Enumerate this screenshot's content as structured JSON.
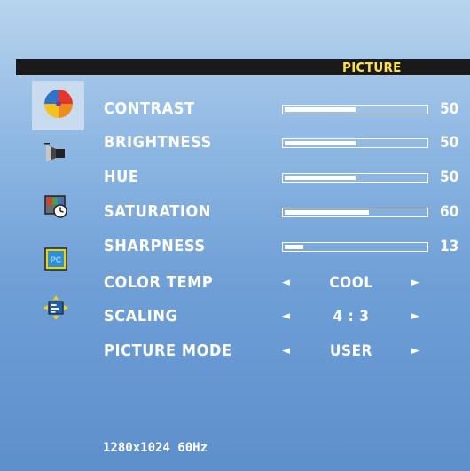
{
  "menu": {
    "title": "PICTURE",
    "icons": [
      {
        "name": "color-wheel-icon",
        "selected": true
      },
      {
        "name": "speaker-icon",
        "selected": false
      },
      {
        "name": "clock-icon",
        "selected": false
      },
      {
        "name": "pc-icon",
        "selected": false
      },
      {
        "name": "settings-icon",
        "selected": false
      }
    ],
    "items": [
      {
        "label": "CONTRAST",
        "type": "slider",
        "value": "50",
        "level": 50,
        "max": 100
      },
      {
        "label": "BRIGHTNESS",
        "type": "slider",
        "value": "50",
        "level": 50,
        "max": 100
      },
      {
        "label": "HUE",
        "type": "slider",
        "value": "50",
        "level": 50,
        "max": 100
      },
      {
        "label": "SATURATION",
        "type": "slider",
        "value": "60",
        "level": 60,
        "max": 100
      },
      {
        "label": "SHARPNESS",
        "type": "slider",
        "value": "13",
        "level": 13,
        "max": 100
      },
      {
        "label": "COLOR TEMP",
        "type": "select",
        "value": "COOL"
      },
      {
        "label": "SCALING",
        "type": "select",
        "value": "4 : 3"
      },
      {
        "label": "PICTURE MODE",
        "type": "select",
        "value": "USER"
      }
    ],
    "arrows": {
      "left": "◄",
      "right": "►"
    }
  },
  "status": {
    "resolution": "1280x1024 60Hz"
  },
  "colors": {
    "title_text": "#ffe24a",
    "title_bar": "#1a1a1a",
    "text": "#ffffff",
    "selection": "#c9dbef"
  }
}
